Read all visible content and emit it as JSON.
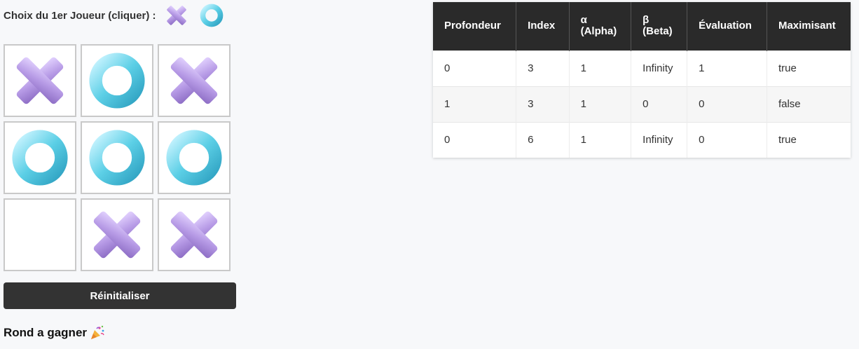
{
  "chooser": {
    "label": "Choix du 1er Joueur (cliquer) :",
    "options": [
      "cross",
      "circle"
    ]
  },
  "board": [
    [
      "cross",
      "circle",
      "cross"
    ],
    [
      "circle",
      "circle",
      "circle"
    ],
    [
      "empty",
      "cross",
      "cross"
    ]
  ],
  "reset_label": "Réinitialiser",
  "status_text": "Rond a gagner",
  "status_icon": "party-popper-icon",
  "table": {
    "headers": [
      "Profondeur",
      "Index",
      "α\n(Alpha)",
      "β\n(Beta)",
      "Évaluation",
      "Maximisant"
    ],
    "rows": [
      [
        "0",
        "3",
        "1",
        "Infinity",
        "1",
        "true"
      ],
      [
        "1",
        "3",
        "1",
        "0",
        "0",
        "false"
      ],
      [
        "0",
        "6",
        "1",
        "Infinity",
        "0",
        "true"
      ]
    ]
  },
  "colors": {
    "cross": "#b79be6",
    "circle": "#5ccfe6",
    "header_bg": "#2a2a2a",
    "button_bg": "#333333"
  }
}
